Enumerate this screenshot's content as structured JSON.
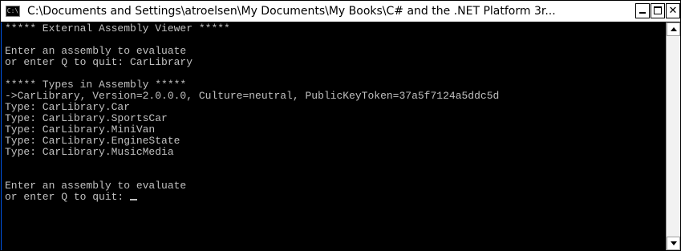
{
  "window": {
    "icon_label": "C:\\",
    "title": "C:\\Documents and Settings\\atroelsen\\My Documents\\My Books\\C# and the .NET Platform 3r..."
  },
  "icons": {
    "app": "console-icon",
    "minimize": "minimize-icon",
    "maximize": "maximize-icon",
    "close": "close-icon",
    "scroll_up": "arrow-up-icon",
    "scroll_down": "arrow-down-icon"
  },
  "console": {
    "lines": [
      "***** External Assembly Viewer *****",
      "",
      "Enter an assembly to evaluate",
      "or enter Q to quit: CarLibrary",
      "",
      "***** Types in Assembly *****",
      "->CarLibrary, Version=2.0.0.0, Culture=neutral, PublicKeyToken=37a5f7124a5ddc5d",
      "Type: CarLibrary.Car",
      "Type: CarLibrary.SportsCar",
      "Type: CarLibrary.MiniVan",
      "Type: CarLibrary.EngineState",
      "Type: CarLibrary.MusicMedia",
      "",
      "",
      "Enter an assembly to evaluate",
      "or enter Q to quit: "
    ]
  },
  "colors": {
    "console_background": "#000000",
    "console_text": "#c0c0c0"
  }
}
